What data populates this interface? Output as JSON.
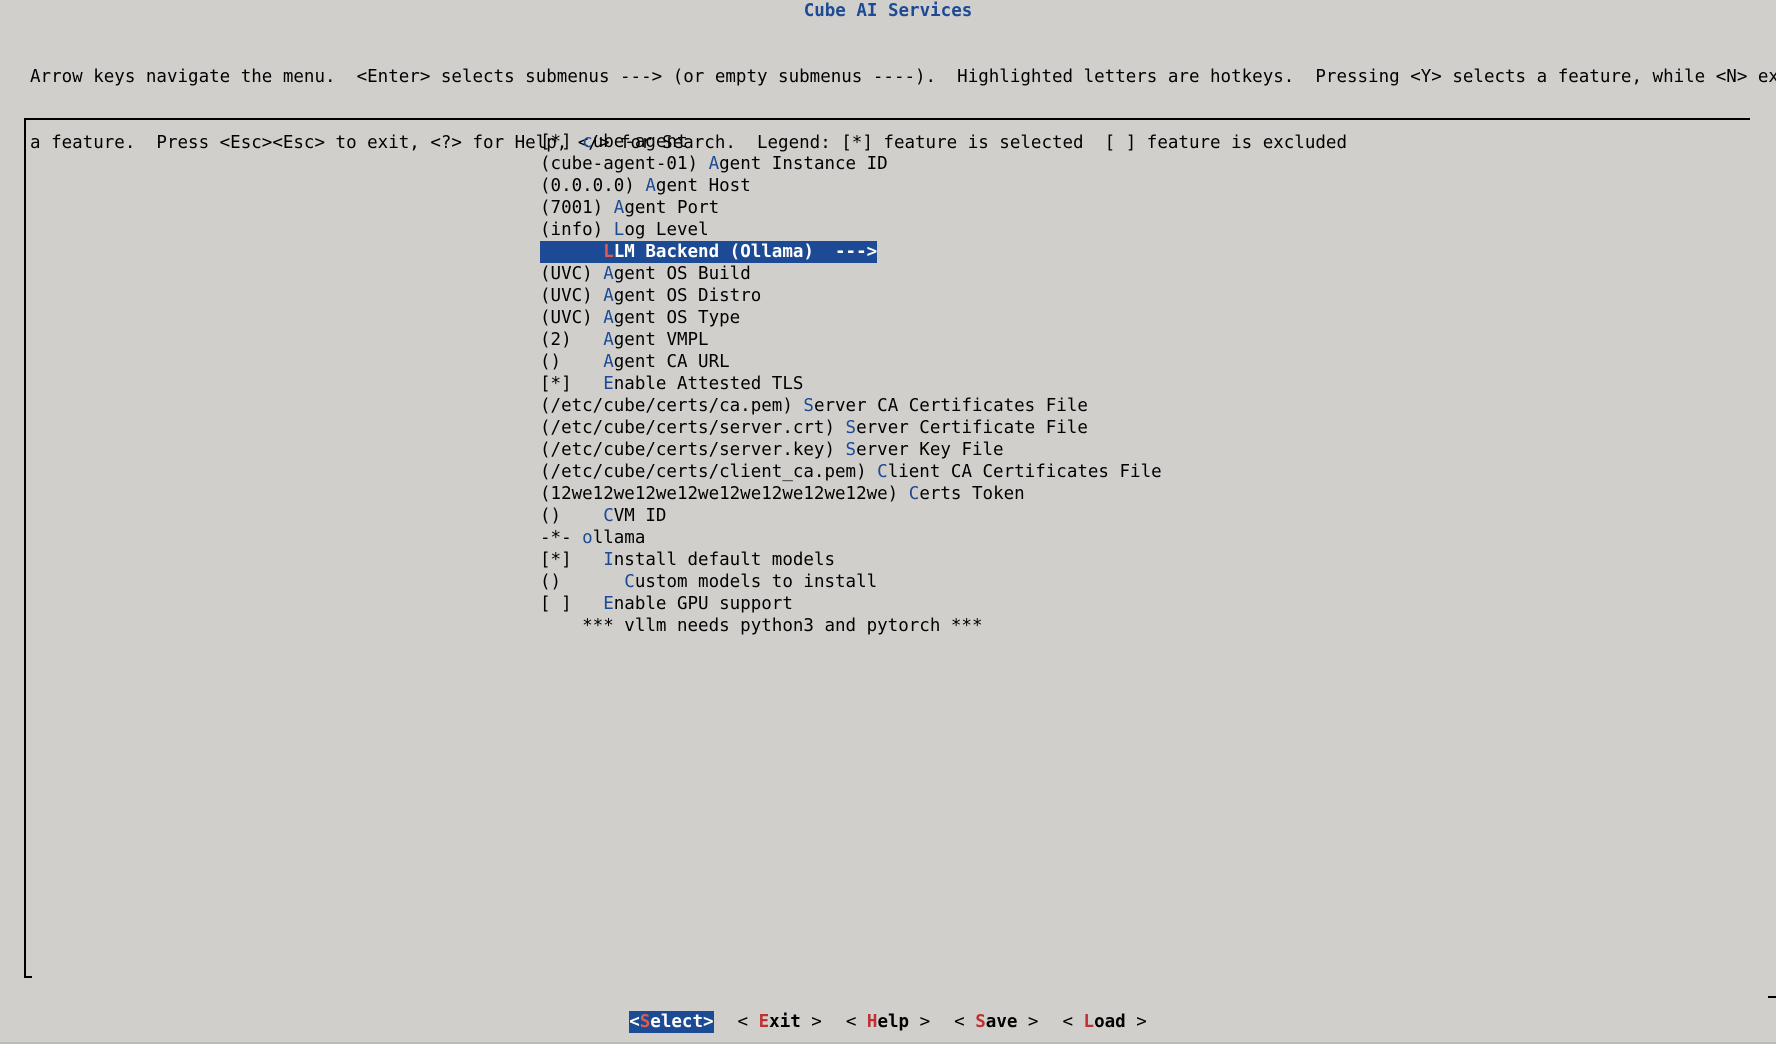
{
  "title": "Cube AI Services",
  "help_lines": [
    "Arrow keys navigate the menu.  <Enter> selects submenus ---> (or empty submenus ----).  Highlighted letters are hotkeys.  Pressing <Y> selects a feature, while <N> excludes",
    "a feature.  Press <Esc><Esc> to exit, <?> for Help, </> for Search.  Legend: [*] feature is selected  [ ] feature is excluded"
  ],
  "menu": [
    {
      "prefix": "[*] ",
      "hotkey": "c",
      "rest": "ube-agent"
    },
    {
      "prefix": "(cube-agent-01) ",
      "hotkey": "A",
      "rest": "gent Instance ID"
    },
    {
      "prefix": "(0.0.0.0) ",
      "hotkey": "A",
      "rest": "gent Host"
    },
    {
      "prefix": "(7001) ",
      "hotkey": "A",
      "rest": "gent Port"
    },
    {
      "prefix": "(info) ",
      "hotkey": "L",
      "rest": "og Level"
    },
    {
      "prefix": "      ",
      "hotkey": "L",
      "rest": "LM Backend (Ollama)  --->"
    },
    {
      "prefix": "(UVC) ",
      "hotkey": "A",
      "rest": "gent OS Build"
    },
    {
      "prefix": "(UVC) ",
      "hotkey": "A",
      "rest": "gent OS Distro"
    },
    {
      "prefix": "(UVC) ",
      "hotkey": "A",
      "rest": "gent OS Type"
    },
    {
      "prefix": "(2)   ",
      "hotkey": "A",
      "rest": "gent VMPL"
    },
    {
      "prefix": "()    ",
      "hotkey": "A",
      "rest": "gent CA URL"
    },
    {
      "prefix": "[*]   ",
      "hotkey": "E",
      "rest": "nable Attested TLS"
    },
    {
      "prefix": "(/etc/cube/certs/ca.pem) ",
      "hotkey": "S",
      "rest": "erver CA Certificates File"
    },
    {
      "prefix": "(/etc/cube/certs/server.crt) ",
      "hotkey": "S",
      "rest": "erver Certificate File"
    },
    {
      "prefix": "(/etc/cube/certs/server.key) ",
      "hotkey": "S",
      "rest": "erver Key File"
    },
    {
      "prefix": "(/etc/cube/certs/client_ca.pem) ",
      "hotkey": "C",
      "rest": "lient CA Certificates File"
    },
    {
      "prefix": "(12we12we12we12we12we12we12we12we) ",
      "hotkey": "C",
      "rest": "erts Token"
    },
    {
      "prefix": "()    ",
      "hotkey": "C",
      "rest": "VM ID"
    },
    {
      "prefix": "-*- ",
      "hotkey": "o",
      "rest": "llama"
    },
    {
      "prefix": "[*]   ",
      "hotkey": "I",
      "rest": "nstall default models"
    },
    {
      "prefix": "()      ",
      "hotkey": "C",
      "rest": "ustom models to install"
    },
    {
      "prefix": "[ ]   ",
      "hotkey": "E",
      "rest": "nable GPU support"
    },
    {
      "prefix": "    *** vllm needs python3 and pytorch ***",
      "hotkey": "",
      "rest": ""
    }
  ],
  "selected_index": 5,
  "buttons": [
    {
      "left": "<",
      "hotkey": "S",
      "rest": "elect",
      "right": ">",
      "active": true
    },
    {
      "left": "< ",
      "hotkey": "E",
      "rest": "xit",
      "right": " >",
      "active": false
    },
    {
      "left": "< ",
      "hotkey": "H",
      "rest": "elp",
      "right": " >",
      "active": false
    },
    {
      "left": "< ",
      "hotkey": "S",
      "rest": "ave",
      "right": " >",
      "active": false
    },
    {
      "left": "< ",
      "hotkey": "L",
      "rest": "oad",
      "right": " >",
      "active": false
    }
  ],
  "colors": {
    "background": "#d0cfcc",
    "accent": "#1c4a94",
    "hotkey_selected": "#e35a4c",
    "button_hotkey": "#c03030"
  }
}
